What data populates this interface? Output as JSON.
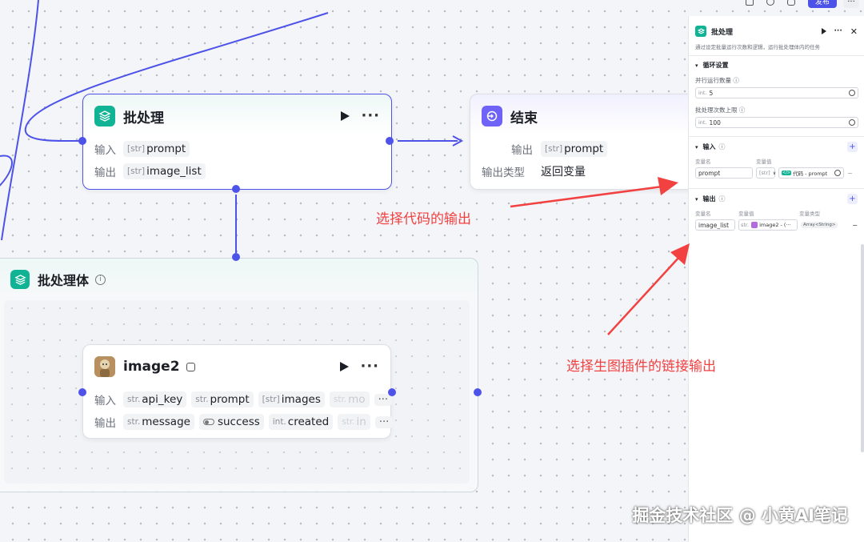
{
  "batch_node": {
    "title": "批处理",
    "input_label": "输入",
    "output_label": "输出",
    "input_type": "[str]",
    "input_name": "prompt",
    "output_type": "[str]",
    "output_name": "image_list"
  },
  "end_node": {
    "title": "结束",
    "output_label": "输出",
    "output_type": "[str]",
    "output_name": "prompt",
    "output_kind_label": "输出类型",
    "output_kind_value": "返回变量"
  },
  "batch_body": {
    "title": "批处理体"
  },
  "image_node": {
    "title": "image2",
    "input_label": "输入",
    "output_label": "输出",
    "inputs": [
      {
        "type": "str.",
        "name": "api_key"
      },
      {
        "type": "str.",
        "name": "prompt"
      },
      {
        "type": "[str]",
        "name": "images"
      },
      {
        "type": "str.",
        "name": "mo"
      }
    ],
    "outputs": [
      {
        "type": "str.",
        "name": "message"
      },
      {
        "type": "toggle",
        "name": "success"
      },
      {
        "type": "int.",
        "name": "created"
      },
      {
        "type": "str.",
        "name": "in"
      }
    ],
    "more": "···"
  },
  "panel": {
    "title": "批处理",
    "description": "通过设定批量运行次数和逻辑，运行批处理体内的任务",
    "loop_section": "循环设置",
    "parallel_label": "并行运行数量",
    "parallel_type": "int.",
    "parallel_value": "5",
    "max_label": "批处理次数上限",
    "max_type": "int.",
    "max_value": "100",
    "input_section": "输入",
    "var_name_col": "变量名",
    "var_value_col": "变量值",
    "input_var_name": "prompt",
    "input_var_type": "[str]",
    "input_var_ref": "代码 - prompt",
    "output_section": "输出",
    "output_type_col": "变量类型",
    "output_var_name": "image_list",
    "output_var_type": "str.",
    "output_var_ref": "image2 - (···",
    "output_var_kind": "Array<String>",
    "add_symbol": "+",
    "remove_symbol": "−"
  },
  "topbar": {
    "publish_label": "发布"
  },
  "annotations": {
    "code_output": "选择代码的输出",
    "plugin_output": "选择生图插件的链接输出"
  },
  "watermark": "掘金技术社区 @ 小黄AI笔记",
  "colors": {
    "accent": "#4d53e8",
    "batch_icon": "#10b394",
    "end_icon": "#6f62f6",
    "annotation": "#f24141"
  }
}
